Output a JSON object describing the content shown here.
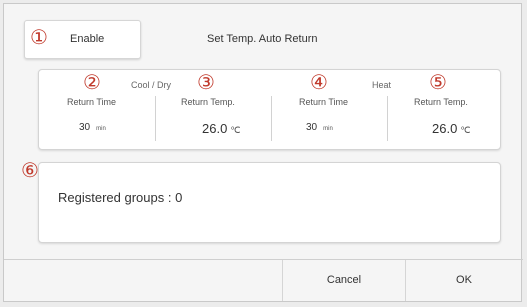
{
  "dialog": {
    "enable_label": "Enable",
    "title": "Set Temp. Auto Return"
  },
  "cool_dry": {
    "group_label": "Cool / Dry",
    "return_time_label": "Return Time",
    "return_time_value": "30",
    "return_time_unit": "min",
    "return_temp_label": "Return Temp.",
    "return_temp_value": "26.0",
    "return_temp_unit": "℃"
  },
  "heat": {
    "group_label": "Heat",
    "return_time_label": "Return Time",
    "return_time_value": "30",
    "return_time_unit": "min",
    "return_temp_label": "Return Temp.",
    "return_temp_value": "26.0",
    "return_temp_unit": "℃"
  },
  "groups": {
    "text": "Registered groups : 0"
  },
  "buttons": {
    "cancel": "Cancel",
    "ok": "OK"
  },
  "callouts": [
    "①",
    "②",
    "③",
    "④",
    "⑤",
    "⑥"
  ],
  "colors": {
    "callout": "#c0392b"
  }
}
